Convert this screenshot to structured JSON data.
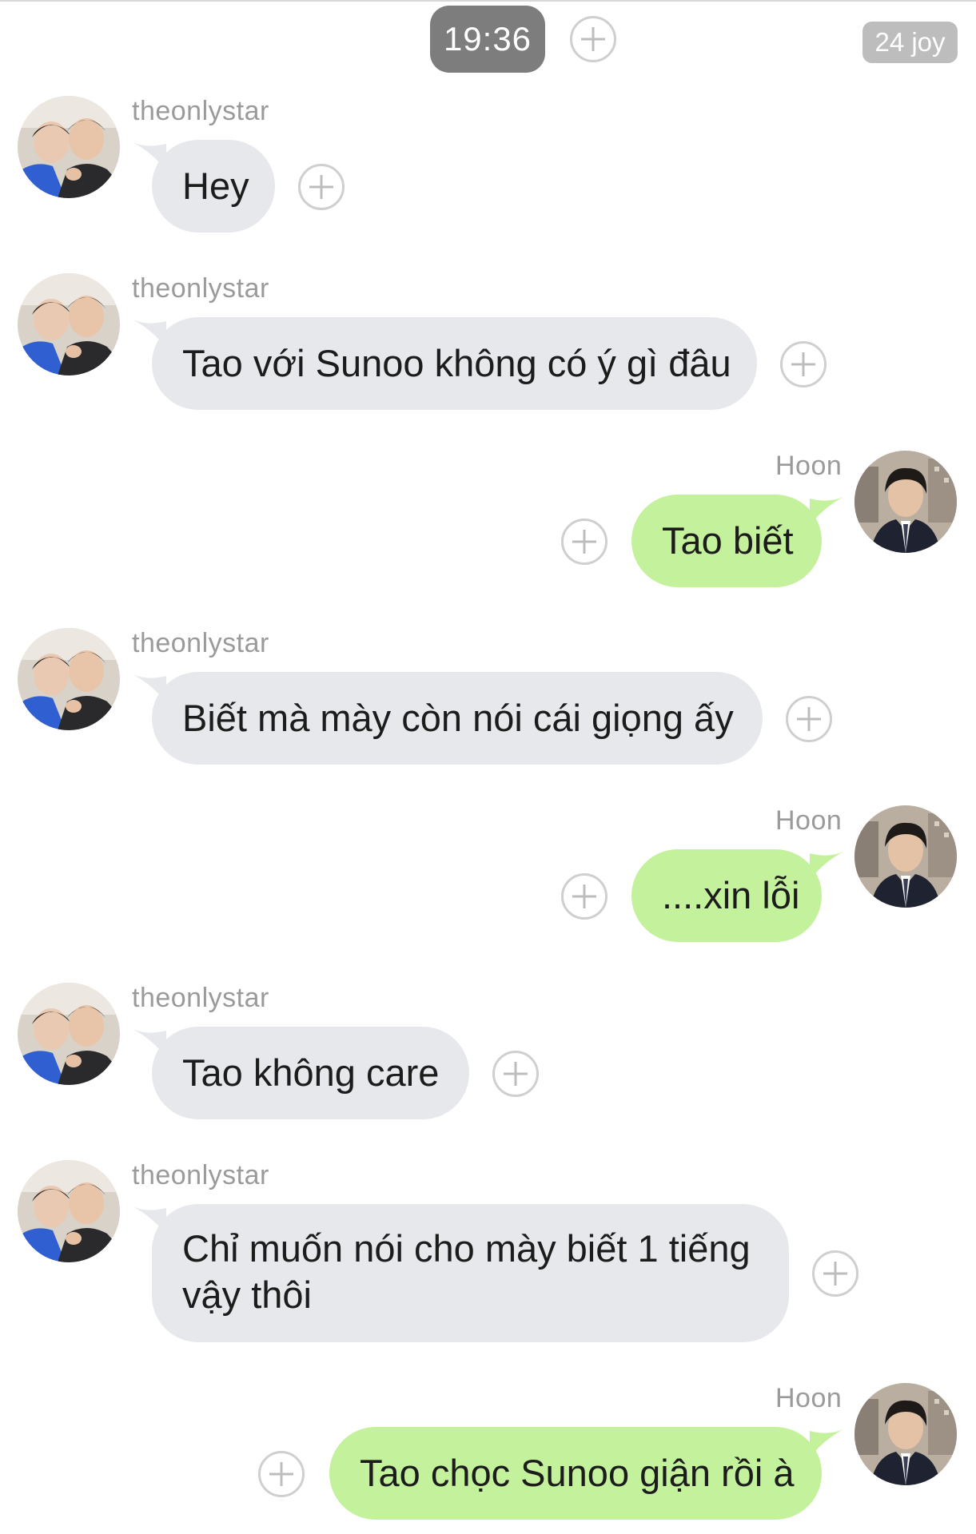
{
  "header": {
    "time": "19:36",
    "badge": "24 joy"
  },
  "contacts": {
    "other": "theonlystar",
    "self": "Hoon"
  },
  "messages": [
    {
      "from": "theonlystar",
      "text": "Hey"
    },
    {
      "from": "theonlystar",
      "text": "Tao với Sunoo không có ý gì đâu"
    },
    {
      "from": "Hoon",
      "text": "Tao biết"
    },
    {
      "from": "theonlystar",
      "text": "Biết mà mày còn nói cái giọng ấy"
    },
    {
      "from": "Hoon",
      "text": "....xin lỗi"
    },
    {
      "from": "theonlystar",
      "text": "Tao không care"
    },
    {
      "from": "theonlystar",
      "text": "Chỉ muốn nói cho mày biết 1 tiếng vậy thôi"
    },
    {
      "from": "Hoon",
      "text": "Tao chọc Sunoo giận rồi à"
    }
  ],
  "colors": {
    "incoming_bubble": "#e6e8eb",
    "outgoing_bubble": "#c4f19c",
    "time_pill": "#7d7d7d"
  }
}
